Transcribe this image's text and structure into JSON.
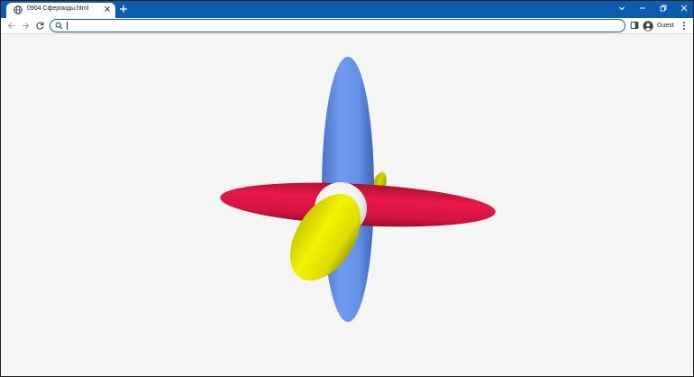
{
  "browser": {
    "tab_title": "0904 Сфероиды.html",
    "omnibox_value": "",
    "profile_label": "Guest"
  },
  "colors": {
    "titlebar": "#0b5cad",
    "accent": "#0b57d0",
    "page_background": "#f5f5f5",
    "red_spheroid": "#dc143c",
    "blue_spheroid": "#6495ed",
    "yellow_spheroid": "#e6e600",
    "center_sphere": "#ffffff"
  },
  "icons": {
    "favicon": "globe-icon",
    "tab_close": "close-icon",
    "new_tab": "plus-icon",
    "tab_search": "chevron-down-icon",
    "minimize": "minimize-icon",
    "restore": "restore-icon",
    "close": "close-icon",
    "back": "back-arrow-icon",
    "forward": "forward-arrow-icon",
    "reload": "reload-icon",
    "omnibox": "search-icon",
    "side_panel": "side-panel-icon",
    "profile": "avatar-icon",
    "menu": "kebab-menu-icon"
  }
}
